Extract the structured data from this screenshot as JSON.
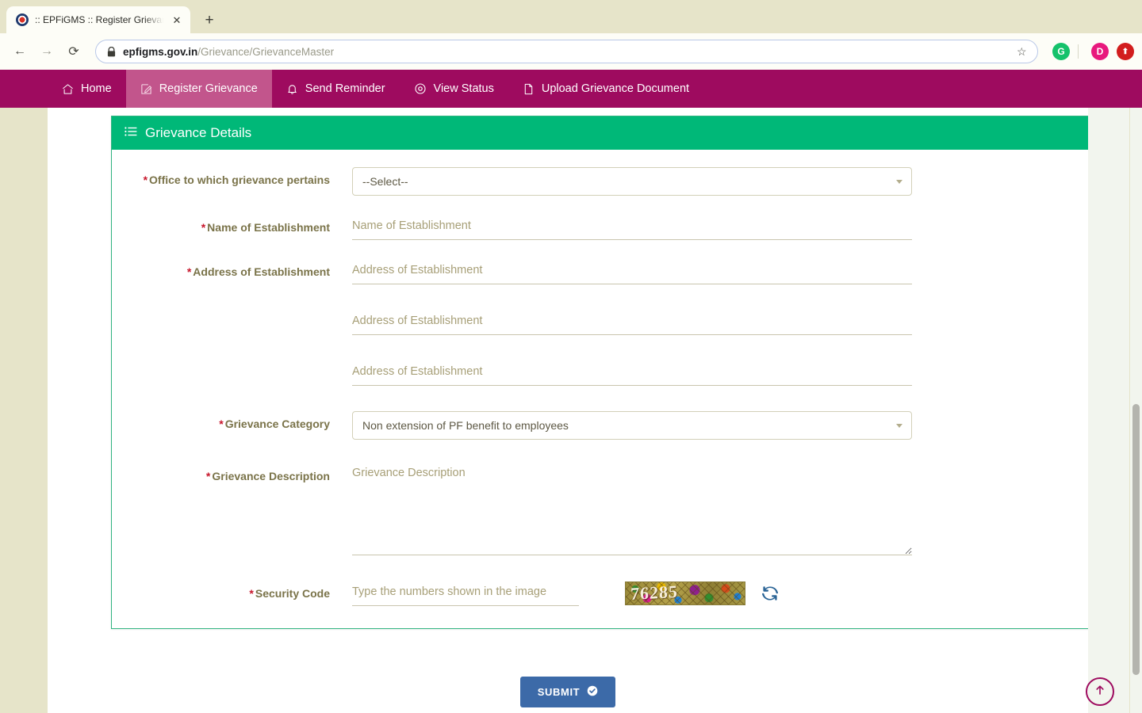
{
  "browser": {
    "tab": {
      "title": ":: EPFiGMS :: Register Grievance",
      "favicon": "epfo-emblem-icon",
      "close": "✕"
    },
    "new_tab": "+",
    "back": "←",
    "forward": "→",
    "reload": "⟳",
    "url_domain": "epfigms.gov.in",
    "url_path": "/Grievance/GrievanceMaster",
    "star": "☆",
    "extensions": [
      {
        "name": "grammarly-extension-icon",
        "letter": "G",
        "color": "#15c26b"
      },
      {
        "name": "profile-avatar",
        "letter": "D",
        "color": "#e8197d"
      },
      {
        "name": "update-extension-icon",
        "letter": "⬆",
        "color": "#d21d1d"
      }
    ]
  },
  "sitenav": {
    "items": [
      {
        "label": "Home",
        "icon": "home-icon",
        "active": false
      },
      {
        "label": "Register Grievance",
        "icon": "edit-square-icon",
        "active": true
      },
      {
        "label": "Send Reminder",
        "icon": "bell-icon",
        "active": false
      },
      {
        "label": "View Status",
        "icon": "eye-icon",
        "active": false
      },
      {
        "label": "Upload Grievance Document",
        "icon": "file-upload-icon",
        "active": false
      }
    ],
    "bar_color": "#9e0b5f",
    "active_color": "#c2558c"
  },
  "card": {
    "header_title": "Grievance Details",
    "header_icon": "list-icon",
    "header_color": "#00b878",
    "border_color": "#2fb380"
  },
  "form": {
    "required_mark": "*",
    "office": {
      "label": "Office to which grievance pertains",
      "value": "--Select--"
    },
    "establishment_name": {
      "label": "Name of Establishment",
      "value": "",
      "placeholder": "Name of Establishment"
    },
    "establishment_address": {
      "label": "Address of Establishment",
      "line1": {
        "value": "",
        "placeholder": "Address of Establishment"
      },
      "line2": {
        "value": "",
        "placeholder": "Address of Establishment"
      },
      "line3": {
        "value": "",
        "placeholder": "Address of Establishment"
      }
    },
    "grievance_category": {
      "label": "Grievance Category",
      "value": "Non extension of PF benefit to employees"
    },
    "grievance_description": {
      "label": "Grievance Description",
      "value": "",
      "placeholder": "Grievance Description"
    },
    "security_code": {
      "label": "Security Code",
      "value": "",
      "placeholder": "Type the numbers shown in the image",
      "captcha_text": "76285",
      "refresh_icon": "refresh-icon"
    }
  },
  "actions": {
    "submit_label": "SUBMIT",
    "submit_icon": "check-circle-icon",
    "submit_color": "#3c6aa8",
    "scroll_top_icon": "arrow-up-circle-icon",
    "scroll_top_color": "#9e0b5f"
  },
  "theme": {
    "page_background": "#e6e4c9",
    "content_background": "#ffffff",
    "label_color": "#7a7349",
    "placeholder_color": "#a79f77",
    "required_color": "#c7162b"
  }
}
